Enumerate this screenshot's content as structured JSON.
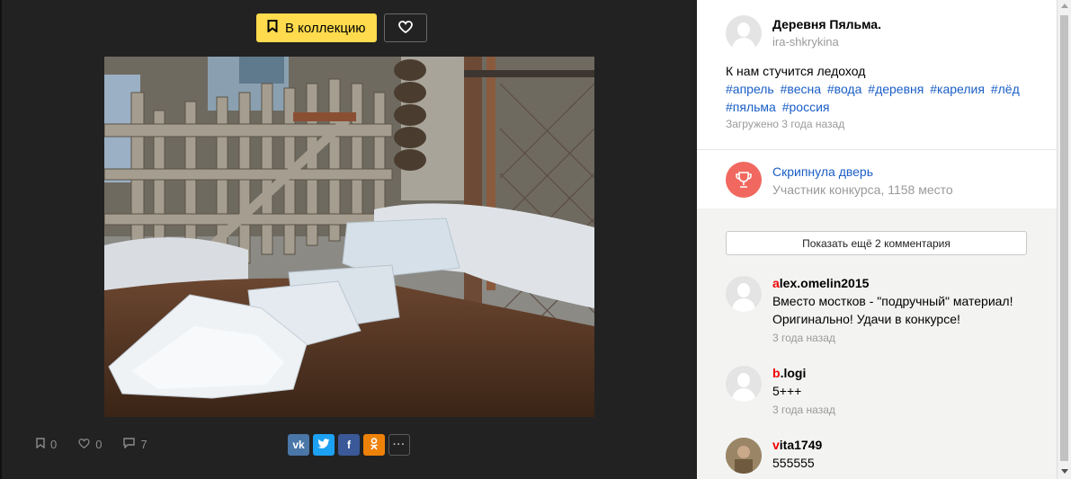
{
  "viewer": {
    "collection_label": "В коллекцию",
    "stats": {
      "saves": "0",
      "likes": "0",
      "comments": "7"
    },
    "share": {
      "vk": "vk",
      "twitter": "t",
      "facebook": "f",
      "ok": "ok",
      "more": "···"
    }
  },
  "author": {
    "name": "Деревня Пяльма.",
    "login": "ira-shkrykina"
  },
  "description": "К нам стучится ледоход",
  "tags": [
    "#апрель",
    "#весна",
    "#вода",
    "#деревня",
    "#карелия",
    "#лёд",
    "#пяльма",
    "#россия"
  ],
  "uploaded": "Загружено 3 года назад",
  "contest": {
    "title": "Скрипнула дверь",
    "place": "Участник конкурса, 1158 место"
  },
  "comments": {
    "show_more": "Показать ещё 2 комментария",
    "items": [
      {
        "user_first": "a",
        "user_rest": "lex.omelin2015",
        "text": "Вместо мостков - \"подручный\" материал! Оригинально! Удачи в конкурсе!",
        "time": "3 года назад"
      },
      {
        "user_first": "b",
        "user_rest": ".logi",
        "text": "5+++",
        "time": "3 года назад"
      },
      {
        "user_first": "v",
        "user_rest": "ita1749",
        "text": "555555",
        "time": ""
      }
    ]
  },
  "colors": {
    "accent": "#ffdb4d",
    "link": "#1a5ec6",
    "trophy": "#f0685f",
    "vk": "#4a76a8",
    "twitter": "#1da1f2",
    "facebook": "#3b5998",
    "ok": "#ee8208"
  }
}
